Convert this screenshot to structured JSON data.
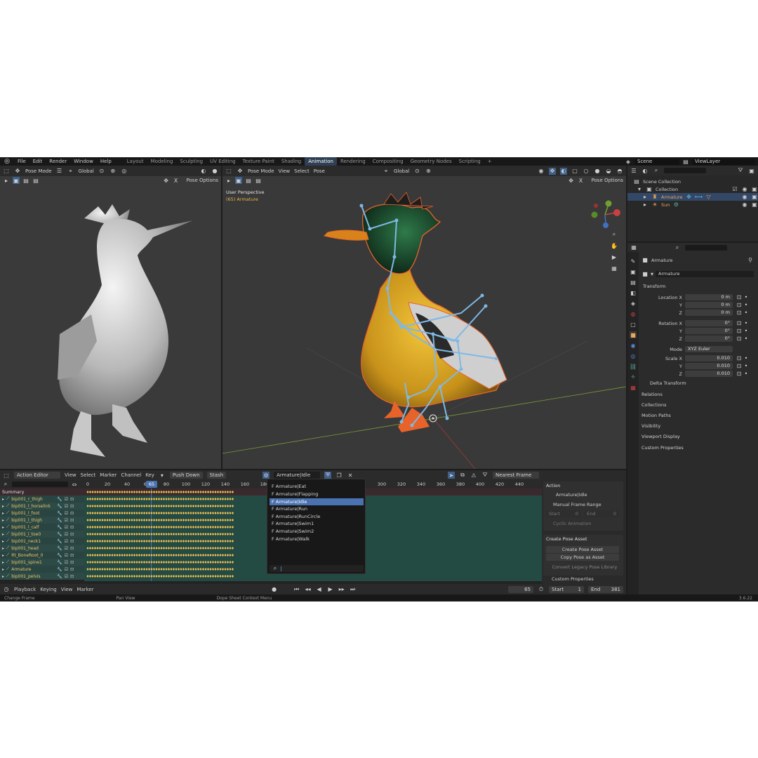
{
  "topbar": {
    "menus": [
      "File",
      "Edit",
      "Render",
      "Window",
      "Help"
    ],
    "workspaces": [
      "Layout",
      "Modeling",
      "Sculpting",
      "UV Editing",
      "Texture Paint",
      "Shading",
      "Animation",
      "Rendering",
      "Compositing",
      "Geometry Nodes",
      "Scripting"
    ],
    "active_workspace": "Animation",
    "add_tab": "+",
    "scene": "Scene",
    "view_layer": "ViewLayer"
  },
  "viewport_left": {
    "mode": "Pose Mode",
    "orientation": "Global",
    "pose_options": "Pose Options"
  },
  "viewport_main": {
    "mode": "Pose Mode",
    "menus": [
      "View",
      "Select",
      "Pose"
    ],
    "orientation": "Global",
    "pose_options": "Pose Options",
    "perspective": "User Perspective",
    "object": "(65) Armature"
  },
  "dopesheet": {
    "editor": "Action Editor",
    "menus": [
      "View",
      "Select",
      "Marker",
      "Channel",
      "Key"
    ],
    "push_down": "Push Down",
    "stash": "Stash",
    "action": "Armature|Idle",
    "snapping": "Nearest Frame",
    "ruler": [
      "0",
      "20",
      "40",
      "60",
      "80",
      "100",
      "120",
      "140",
      "160",
      "180",
      "300",
      "320",
      "340",
      "360",
      "380",
      "400",
      "420",
      "440"
    ],
    "current_frame": "65",
    "summary_label": "Summary",
    "channels": [
      "bip001_r_thigh",
      "bip001_l_horselink",
      "bip001_l_foot",
      "bip001_l_thigh",
      "bip001_l_calf",
      "bip001_l_toe0",
      "bip001_neck1",
      "bip001_head",
      "Rt_BoneRoot_0",
      "bip001_spine1",
      "Armature",
      "bip001_pelvis"
    ]
  },
  "action_dropdown": {
    "items": [
      "F Armature|Eat",
      "F Armature|Flapping",
      "F Armature|Idle",
      "F Armature|Run",
      "F Armature|RunCircle",
      "F Armature|Swim1",
      "F Armature|Swim2",
      "F Armature|Walk"
    ],
    "selected_index": 2
  },
  "dope_side": {
    "action_header": "Action",
    "action_name": "Armature|Idle",
    "manual_range": "Manual Frame Range",
    "start_label": "Start",
    "start_val": "0",
    "end_label": "End",
    "end_val": "0",
    "cyclic": "Cyclic Animation",
    "pose_asset_header": "Create Pose Asset",
    "create_pose_asset": "Create Pose Asset",
    "copy_pose_asset": "Copy Pose as Asset",
    "convert_legacy": "Convert Legacy Pose Library",
    "custom_props": "Custom Properties"
  },
  "timeline": {
    "menus": [
      "Playback",
      "Keying",
      "View",
      "Marker"
    ],
    "frame": "65",
    "start_label": "Start",
    "start": "1",
    "end_label": "End",
    "end": "381"
  },
  "outliner": {
    "scene_collection": "Scene Collection",
    "collection": "Collection",
    "armature": "Armature",
    "sun": "Sun"
  },
  "properties": {
    "object_name": "Armature",
    "data_name": "Armature",
    "transform": "Transform",
    "location_label": "Location X",
    "loc": [
      "0 m",
      "0 m",
      "0 m"
    ],
    "rotation_label": "Rotation X",
    "rot": [
      "0°",
      "0°",
      "0°"
    ],
    "y_label": "Y",
    "z_label": "Z",
    "mode_label": "Mode",
    "mode": "XYZ Euler",
    "scale_label": "Scale X",
    "scale": [
      "0.010",
      "0.010",
      "0.010"
    ],
    "sections": [
      "Delta Transform",
      "Relations",
      "Collections",
      "Motion Paths",
      "Visibility",
      "Viewport Display",
      "Custom Properties"
    ]
  },
  "status": {
    "items": [
      "Change Frame",
      "Pan View",
      "Dope Sheet Context Menu"
    ],
    "version": "3.6.22"
  },
  "colors": {
    "accent": "#4a72b0",
    "bone": "#7fb8e6",
    "outline": "#e8632a"
  }
}
